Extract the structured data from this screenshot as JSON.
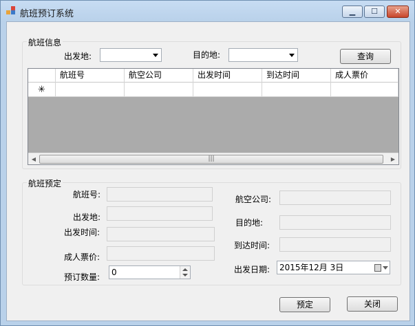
{
  "window": {
    "title": "航班预订系统",
    "min_glyph": "▁",
    "max_glyph": "☐",
    "close_glyph": "✕"
  },
  "search": {
    "group_title": "航班信息",
    "from_label": "出发地:",
    "from_value": "",
    "to_label": "目的地:",
    "to_value": "",
    "query_button": "查询"
  },
  "grid": {
    "columns": [
      "航班号",
      "航空公司",
      "出发时间",
      "到达时间",
      "成人票价"
    ],
    "new_row_marker": "✳",
    "scroll_left": "◀",
    "scroll_right": "▶",
    "thumb_grip": "|||"
  },
  "booking": {
    "group_title": "航班预定",
    "flight_no_label": "航班号:",
    "airline_label": "航空公司:",
    "from_label": "出发地:",
    "to_label": "目的地:",
    "depart_time_label": "出发时间:",
    "arrive_time_label": "到达时间:",
    "adult_price_label": "成人票价:",
    "quantity_label": "预订数量:",
    "quantity_value": "0",
    "depart_date_label": "出发日期:",
    "depart_date_value": "2015年12月  3日"
  },
  "actions": {
    "book_button": "预定",
    "close_button": "关闭"
  }
}
